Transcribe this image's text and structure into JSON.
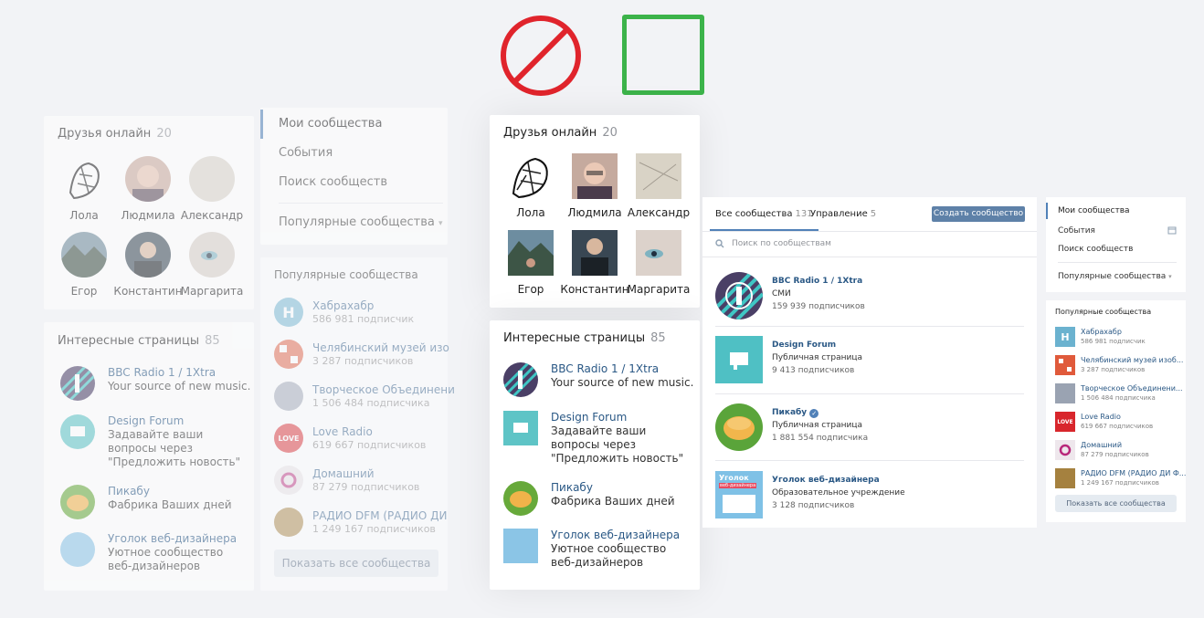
{
  "friends": {
    "title": "Друзья онлайн",
    "count": "20",
    "people": [
      {
        "name": "Лола"
      },
      {
        "name": "Людмила"
      },
      {
        "name": "Александр"
      },
      {
        "name": "Егор"
      },
      {
        "name": "Константин"
      },
      {
        "name": "Маргарита"
      }
    ]
  },
  "interesting": {
    "title": "Интересные страницы",
    "count": "85",
    "pages": [
      {
        "name": "BBC Radio 1 / 1Xtra",
        "desc": "Your source of new music."
      },
      {
        "name": "Design Forum",
        "desc": "Задавайте ваши вопросы через \"Предложить новость\""
      },
      {
        "name": "Пикабу",
        "desc": "Фабрика Ваших дней"
      },
      {
        "name": "Уголок веб-дизайнера",
        "desc": "Уютное сообщество веб-дизайнеров"
      }
    ]
  },
  "menu": {
    "my": "Мои сообщества",
    "events": "События",
    "search": "Поиск сообществ",
    "popular": "Популярные сообщества"
  },
  "popular": {
    "title": "Популярные сообщества",
    "items": [
      {
        "name": "Хабрахабр",
        "subs_left": "586 981 подписчик",
        "subs_right": "586 981 подписчик"
      },
      {
        "name_left": "Челябинский музей изо",
        "name_right": "Челябинский музей изоб...",
        "subs": "3 287 подписчиков"
      },
      {
        "name_left": "Творческое Объединени",
        "name_right": "Творческое Объединени...",
        "subs": "1 506 484 подписчика"
      },
      {
        "name": "Love Radio",
        "subs": "619 667 подписчиков"
      },
      {
        "name": "Домашний",
        "subs": "87 279 подписчиков"
      },
      {
        "name_left": "РАДИО DFM (РАДИО ДИ",
        "name_right": "РАДИО DFM (РАДИО ДИ Ф...",
        "subs": "1 249 167 подписчиков"
      }
    ],
    "show_all": "Показать все сообщества"
  },
  "communities_page": {
    "tab_all": "Все сообщества",
    "tab_all_count": "131",
    "tab_manage": "Управление",
    "tab_manage_count": "5",
    "create_button": "Создать сообщество",
    "search_placeholder": "Поиск по сообществам",
    "items": [
      {
        "name": "BBC Radio 1 / 1Xtra",
        "type": "СМИ",
        "subs": "159 939 подписчиков"
      },
      {
        "name": "Design Forum",
        "type": "Публичная страница",
        "subs": "9 413 подписчиков"
      },
      {
        "name": "Пикабу",
        "type": "Публичная страница",
        "subs": "1 881 554 подписчика"
      },
      {
        "name": "Уголок веб-дизайнера",
        "type": "Образовательное учреждение",
        "subs": "3 128 подписчиков"
      }
    ]
  },
  "logo_texts": {
    "habr": "H",
    "love": "LOVE",
    "ugolok1": "Уголок",
    "ugolok2": "веб-дизайнера"
  },
  "colors": {
    "accent": "#5181b8",
    "forbid": "#e0242c",
    "ok": "#3cb34a",
    "create_button": "#5e81a8"
  }
}
